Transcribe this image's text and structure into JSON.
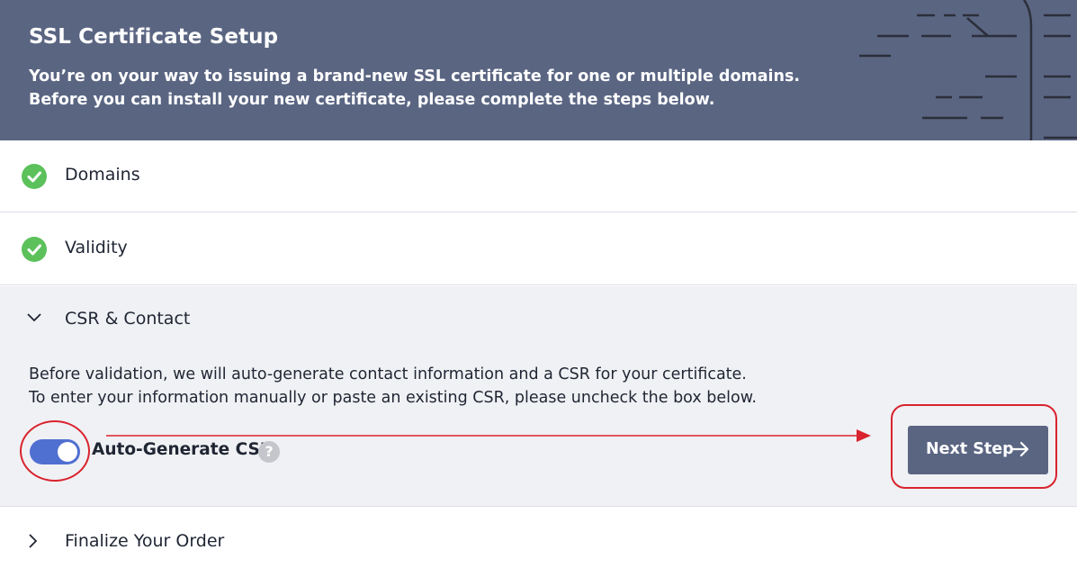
{
  "header": {
    "title": "SSL Certificate Setup",
    "description_line1": "You’re on your way to issuing a brand-new SSL certificate for one or multiple domains.",
    "description_line2": "Before you can install your new certificate, please complete the steps below."
  },
  "steps": [
    {
      "label": "Domains",
      "status": "completed",
      "icon": "check-circle-icon"
    },
    {
      "label": "Validity",
      "status": "completed",
      "icon": "check-circle-icon"
    },
    {
      "label": "CSR & Contact",
      "status": "expanded",
      "icon": "chevron-down-icon"
    },
    {
      "label": "Finalize Your Order",
      "status": "collapsed",
      "icon": "chevron-right-icon"
    }
  ],
  "csr": {
    "description_line1": "Before validation, we will auto-generate contact information and a CSR for your certificate.",
    "description_line2": "To enter your information manually or paste an existing CSR, please uncheck the box below.",
    "toggle_label": "Auto-Generate CSR",
    "toggle_on": true,
    "help_icon": "?",
    "next_button_label": "Next Step"
  },
  "colors": {
    "header_bg": "#5a6582",
    "check_green": "#5cc15b",
    "toggle_blue": "#4f6fd1",
    "button_bg": "#5a6582",
    "annotation_red": "#d9232e",
    "section_bg": "#f0f1f4"
  }
}
